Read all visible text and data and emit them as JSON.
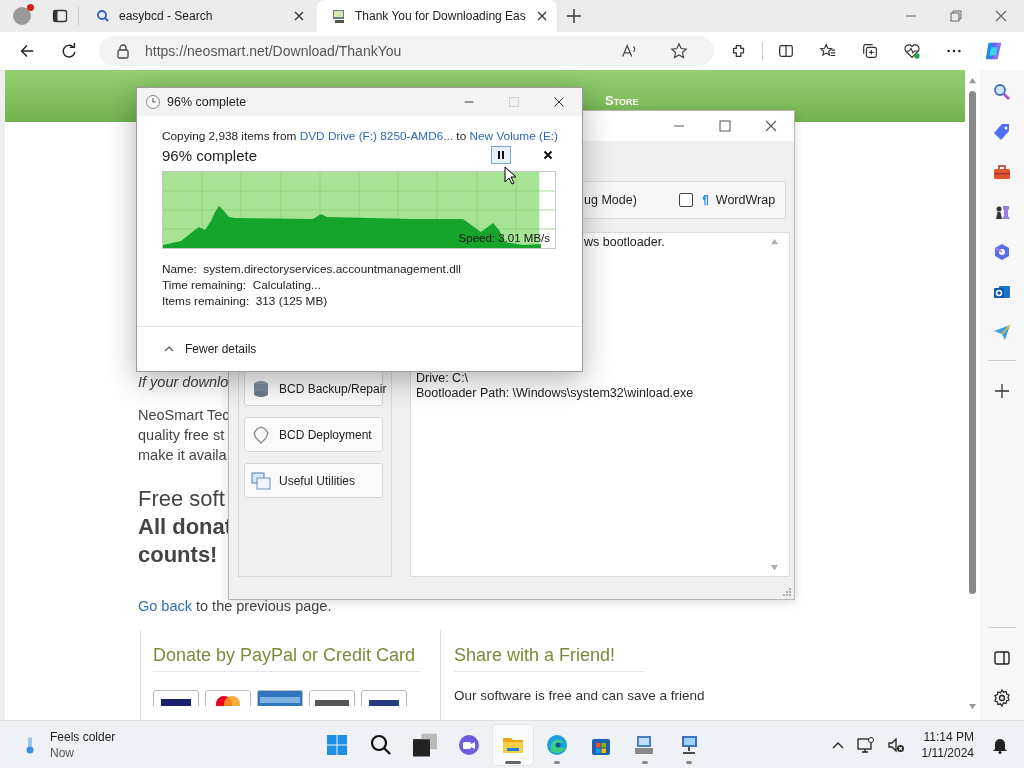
{
  "browser": {
    "tabs": [
      {
        "title": "easybcd - Search",
        "selected": false
      },
      {
        "title": "Thank You for Downloading Eas",
        "selected": true
      }
    ],
    "address": "https://neosmart.net/Download/ThankYou"
  },
  "page": {
    "nav": [
      "Store"
    ],
    "note": "If your downlo",
    "paragraph": [
      "NeoSmart Tec",
      "quality free st",
      "make it availa"
    ],
    "heading": "Free soft",
    "bold_heading": [
      "All donat",
      "counts!"
    ],
    "back_link": "Go back",
    "back_text": "to the previous page.",
    "donate_title": "Donate by PayPal or Credit Card",
    "share_title": "Share with a Friend!",
    "share_text": "Our software is free and can save a friend"
  },
  "easybcd": {
    "option_text": "ug Mode)",
    "wordwrap": {
      "label": "WordWrap",
      "checked": false
    },
    "menu": [
      "BCD Backup/Repair",
      "BCD Deployment",
      "Useful Utilities"
    ],
    "output_tail": "ws bootloader.",
    "output_lines": [
      "Drive: C:\\",
      "Bootloader Path: \\Windows\\system32\\winload.exe"
    ]
  },
  "copy_dialog": {
    "title": "96% complete",
    "summary": {
      "prefix": "Copying 2,938 items from",
      "source": "DVD Drive (F:) 8250-AMD6...",
      "middle": "to",
      "destination": "New Volume (E:)"
    },
    "status": "96% complete",
    "level": 0.96,
    "speed": "Speed: 3.01 MB/s",
    "details": [
      {
        "label": "Name:",
        "value": "system.directoryservices.accountmanagement.dll"
      },
      {
        "label": "Time remaining:",
        "value": "Calculating..."
      },
      {
        "label": "Items remaining:",
        "value": "313 (125 MB)"
      }
    ],
    "toggle": "Fewer details"
  },
  "taskbar": {
    "weather": {
      "title": "Feels colder",
      "subtitle": "Now"
    },
    "apps": [
      {
        "kind": "start",
        "selected": false,
        "running": false
      },
      {
        "kind": "search",
        "selected": false,
        "running": false
      },
      {
        "kind": "taskview",
        "selected": false,
        "running": false
      },
      {
        "kind": "chat",
        "selected": false,
        "running": false
      },
      {
        "kind": "explorer",
        "selected": true,
        "running": true
      },
      {
        "kind": "edge",
        "selected": false,
        "running": true
      },
      {
        "kind": "store",
        "selected": false,
        "running": false
      },
      {
        "kind": "setup",
        "selected": false,
        "running": true
      },
      {
        "kind": "network",
        "selected": false,
        "running": true
      }
    ],
    "time": "11:14 PM",
    "date": "1/11/2024"
  }
}
